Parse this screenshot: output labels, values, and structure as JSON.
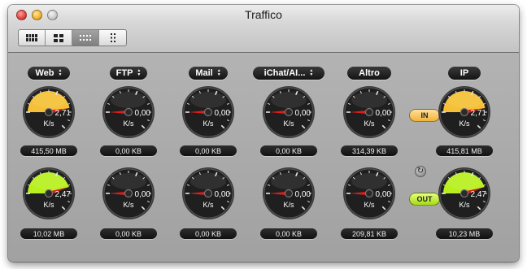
{
  "window": {
    "title": "Traffico",
    "view_modes": [
      {
        "icon": "grid-icon",
        "active": false
      },
      {
        "icon": "two-column-icon",
        "active": false
      },
      {
        "icon": "compact-grid-icon",
        "active": true
      },
      {
        "icon": "vertical-list-icon",
        "active": false
      }
    ]
  },
  "colors": {
    "gauge_in_fill": "#f5c036",
    "gauge_out_fill": "#b8f01f",
    "needle": "#d81f1f"
  },
  "gauges": {
    "in": [
      {
        "name": "Web",
        "has_menu": true,
        "speed": "2,71",
        "unit": "K/s",
        "total": "415,50 MB",
        "level": 0.75
      },
      {
        "name": "FTP",
        "has_menu": true,
        "speed": "0,00",
        "unit": "K/s",
        "total": "0,00 KB",
        "level": 0
      },
      {
        "name": "Mail",
        "has_menu": true,
        "speed": "0,00",
        "unit": "K/s",
        "total": "0,00 KB",
        "level": 0
      },
      {
        "name": "iChat/AI...",
        "has_menu": true,
        "speed": "0,00",
        "unit": "K/s",
        "total": "0,00 KB",
        "level": 0
      },
      {
        "name": "Altro",
        "has_menu": false,
        "speed": "0,00",
        "unit": "K/s",
        "total": "314,39 KB",
        "level": 0
      },
      {
        "name": "IP",
        "has_menu": false,
        "speed": "2,71",
        "unit": "K/s",
        "total": "415,81 MB",
        "level": 0.75
      }
    ],
    "out": [
      {
        "speed": "2,47",
        "unit": "K/s",
        "total": "10,02 MB",
        "level": 0.72
      },
      {
        "speed": "0,00",
        "unit": "K/s",
        "total": "0,00 KB",
        "level": 0
      },
      {
        "speed": "0,00",
        "unit": "K/s",
        "total": "0,00 KB",
        "level": 0
      },
      {
        "speed": "0,00",
        "unit": "K/s",
        "total": "0,00 KB",
        "level": 0
      },
      {
        "speed": "0,00",
        "unit": "K/s",
        "total": "209,81 KB",
        "level": 0
      },
      {
        "speed": "2,47",
        "unit": "K/s",
        "total": "10,23 MB",
        "level": 0.72
      }
    ]
  },
  "buttons": {
    "in_label": "IN",
    "out_label": "OUT",
    "reload_icon": "refresh-icon"
  }
}
